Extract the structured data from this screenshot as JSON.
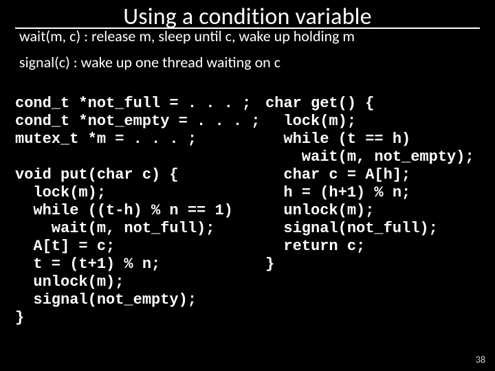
{
  "title": "Using a condition variable",
  "desc_wait": "wait(m, c) : release m, sleep until c, wake up holding m",
  "desc_signal": "signal(c) : wake up one thread waiting on c",
  "code_left": "cond_t *not_full = . . . ;\ncond_t *not_empty = . . . ;\nmutex_t *m = . . . ;\n\nvoid put(char c) {\n  lock(m);\n  while ((t-h) % n == 1)\n    wait(m, not_full);\n  A[t] = c;\n  t = (t+1) % n;\n  unlock(m);\n  signal(not_empty);\n}",
  "code_right": "char get() {\n  lock(m);\n  while (t == h)\n    wait(m, not_empty);\n  char c = A[h];\n  h = (h+1) % n;\n  unlock(m);\n  signal(not_full);\n  return c;\n}",
  "page_number": "38"
}
